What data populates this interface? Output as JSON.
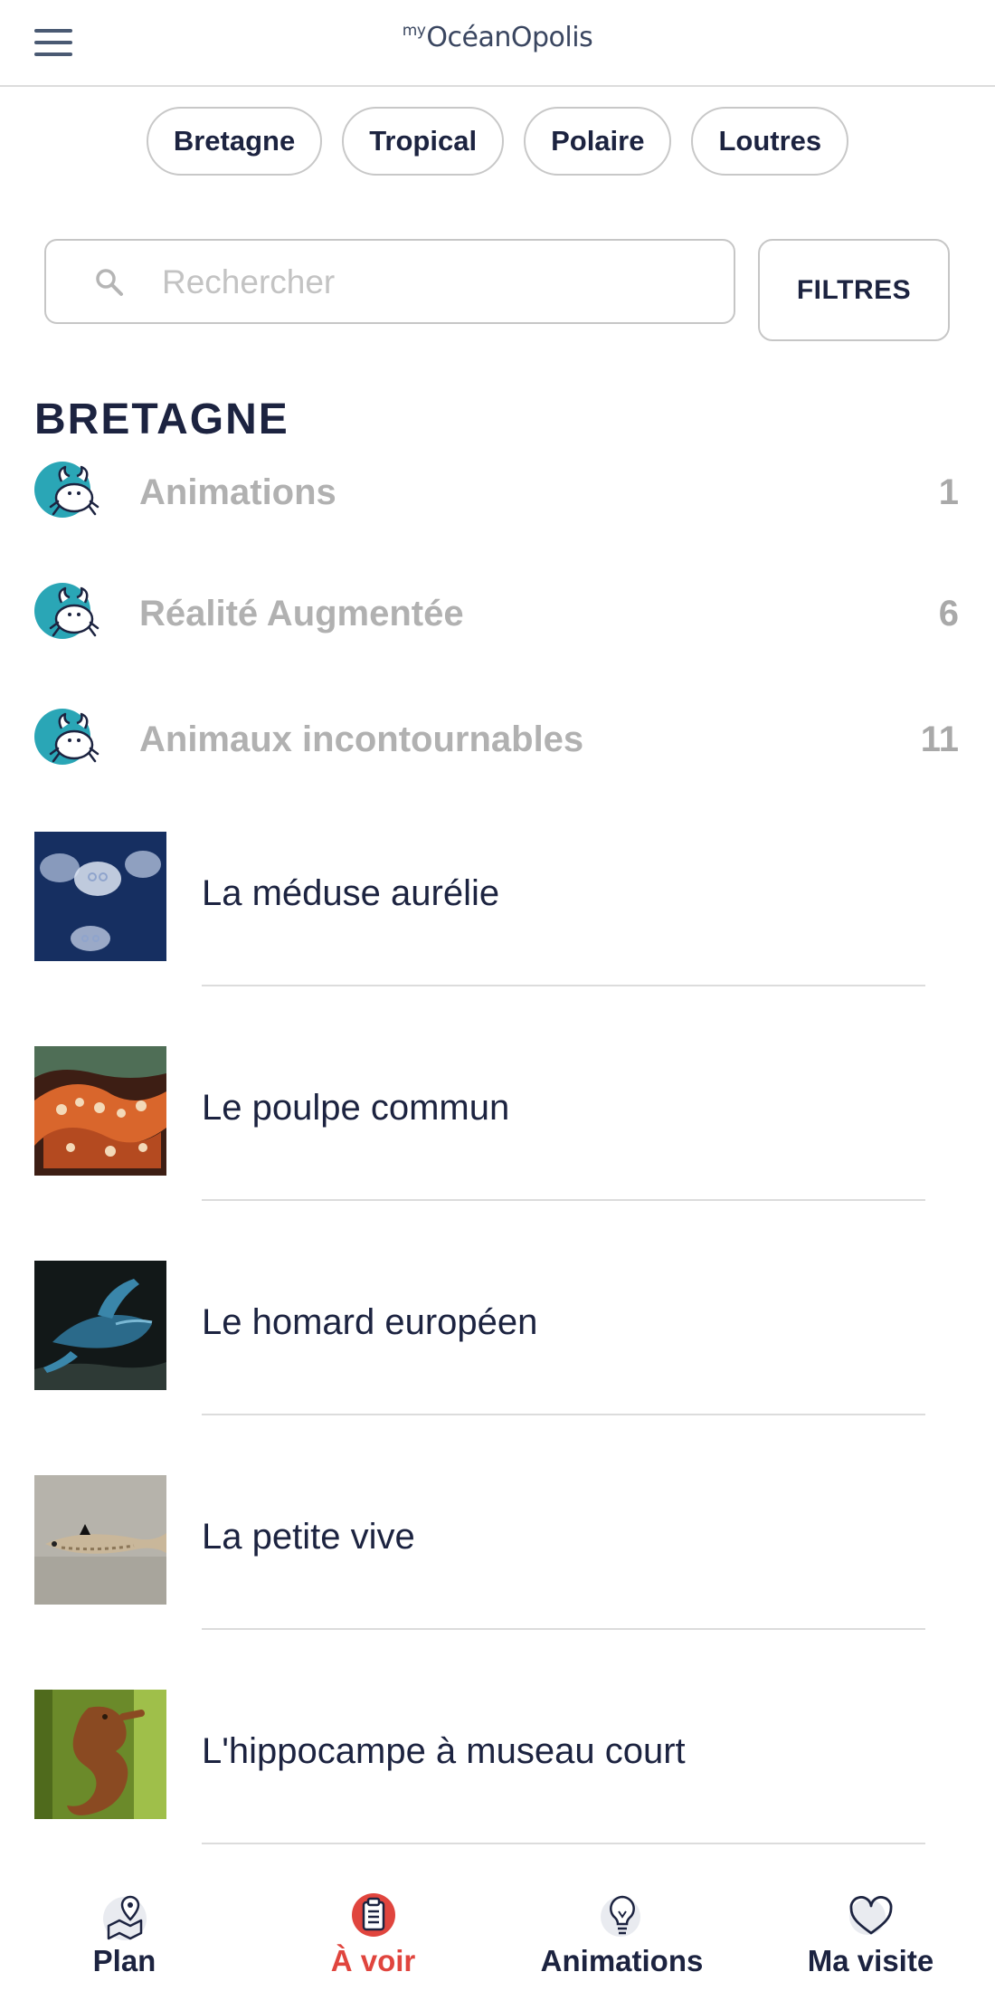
{
  "header": {
    "logo_prefix": "my",
    "logo_text": "OcéanOpolis"
  },
  "chips": [
    {
      "label": "Bretagne"
    },
    {
      "label": "Tropical"
    },
    {
      "label": "Polaire"
    },
    {
      "label": "Loutres"
    }
  ],
  "search": {
    "placeholder": "Rechercher",
    "value": ""
  },
  "filters_label": "FILTRES",
  "section": {
    "title": "BRETAGNE"
  },
  "categories": [
    {
      "label": "Animations",
      "count": "1",
      "icon": "crab-icon"
    },
    {
      "label": "Réalité Augmentée",
      "count": "6",
      "icon": "crab-icon"
    },
    {
      "label": "Animaux incontournables",
      "count": "11",
      "icon": "crab-icon"
    }
  ],
  "species": [
    {
      "label": "La méduse aurélie",
      "image": "jellyfish-photo"
    },
    {
      "label": "Le poulpe commun",
      "image": "octopus-photo"
    },
    {
      "label": "Le homard européen",
      "image": "lobster-photo"
    },
    {
      "label": "La petite vive",
      "image": "weever-fish-photo"
    },
    {
      "label": "L'hippocampe à museau court",
      "image": "seahorse-photo"
    }
  ],
  "nav": [
    {
      "label": "Plan",
      "icon": "map-pin-icon",
      "active": false
    },
    {
      "label": "À voir",
      "icon": "clipboard-icon",
      "active": true
    },
    {
      "label": "Animations",
      "icon": "lightbulb-icon",
      "active": false
    },
    {
      "label": "Ma visite",
      "icon": "heart-icon",
      "active": false
    }
  ],
  "colors": {
    "text_primary": "#1c2340",
    "accent_active": "#e0453e",
    "muted": "#b1b1b1",
    "icon_teal": "#2aa6b6"
  }
}
